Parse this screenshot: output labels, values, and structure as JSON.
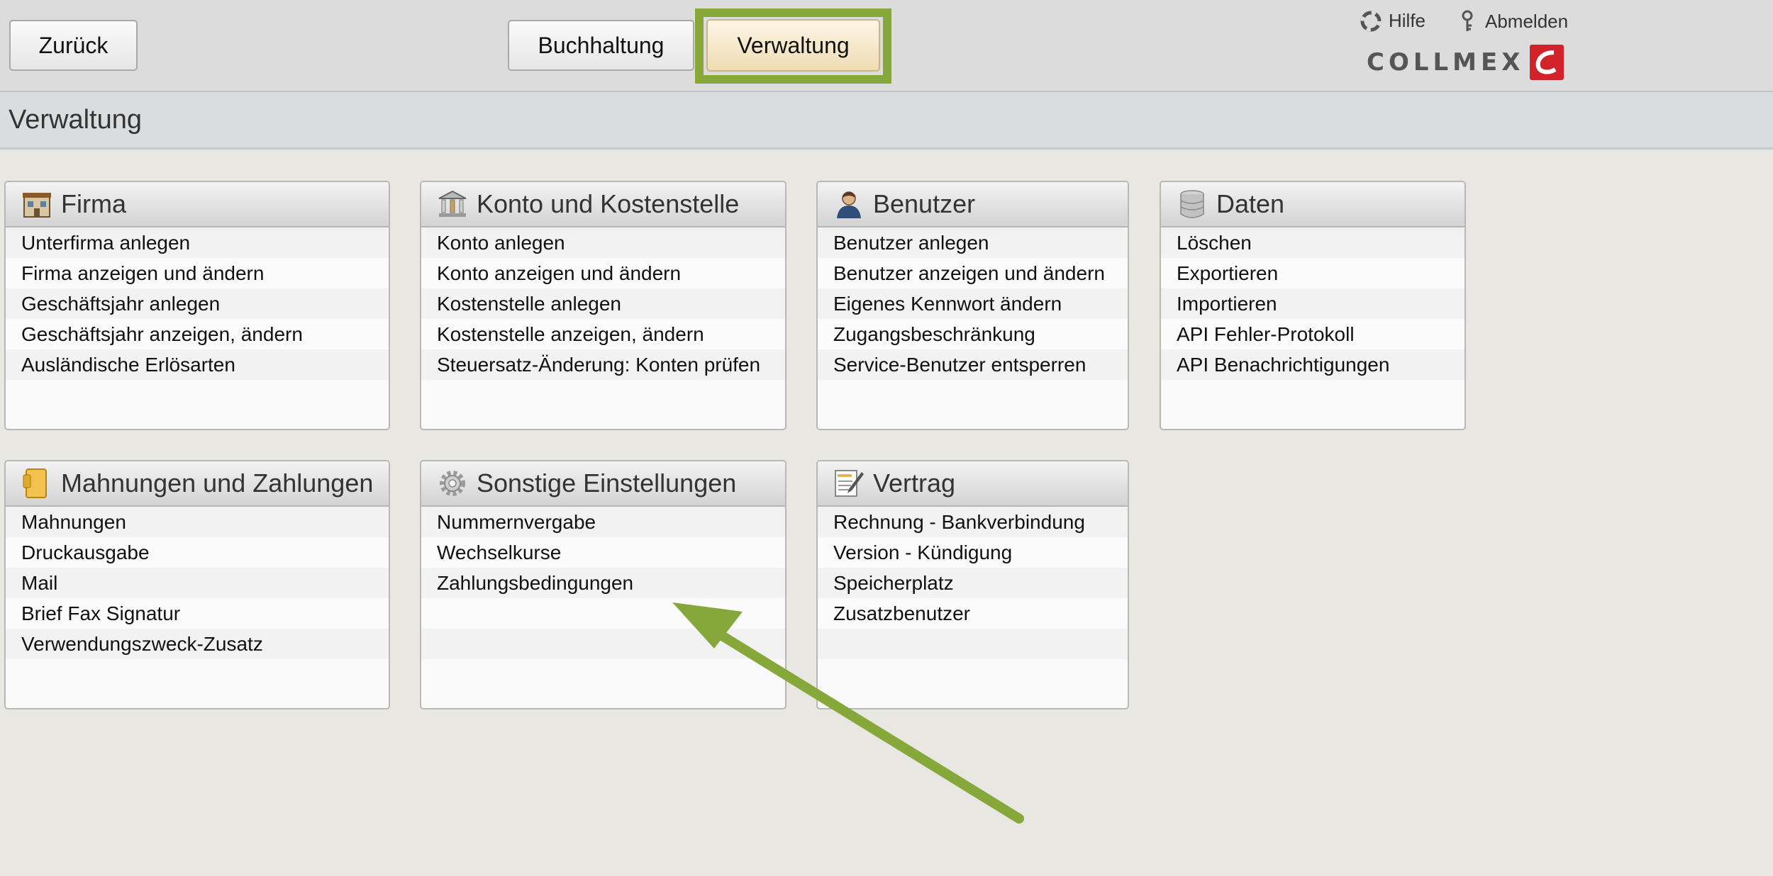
{
  "toolbar": {
    "back_label": "Zurück",
    "buchhaltung_label": "Buchhaltung",
    "verwaltung_label": "Verwaltung",
    "help_label": "Hilfe",
    "logout_label": "Abmelden",
    "logo_text": "COLLMEX"
  },
  "page": {
    "title": "Verwaltung"
  },
  "panels": [
    {
      "title": "Firma",
      "icon": "building-icon",
      "items": [
        "Unterfirma anlegen",
        "Firma anzeigen und ändern",
        "Geschäftsjahr anlegen",
        "Geschäftsjahr anzeigen, ändern",
        "Ausländische Erlösarten"
      ]
    },
    {
      "title": "Konto und Kostenstelle",
      "icon": "bank-icon",
      "items": [
        "Konto anlegen",
        "Konto anzeigen und ändern",
        "Kostenstelle anlegen",
        "Kostenstelle anzeigen, ändern",
        "Steuersatz-Änderung: Konten prüfen"
      ]
    },
    {
      "title": "Benutzer",
      "icon": "user-icon",
      "items": [
        "Benutzer anlegen",
        "Benutzer anzeigen und ändern",
        "Eigenes Kennwort ändern",
        "Zugangsbeschränkung",
        "Service-Benutzer entsperren"
      ]
    },
    {
      "title": "Daten",
      "icon": "database-icon",
      "items": [
        "Löschen",
        "Exportieren",
        "Importieren",
        "API Fehler-Protokoll",
        "API Benachrichtigungen"
      ]
    },
    {
      "title": "Mahnungen und Zahlungen",
      "icon": "folder-icon",
      "items": [
        "Mahnungen",
        "Druckausgabe",
        "Mail",
        "Brief Fax Signatur",
        "Verwendungszweck-Zusatz"
      ]
    },
    {
      "title": "Sonstige Einstellungen",
      "icon": "gear-icon",
      "items": [
        "Nummernvergabe",
        "Wechselkurse",
        "Zahlungsbedingungen",
        "",
        ""
      ]
    },
    {
      "title": "Vertrag",
      "icon": "contract-icon",
      "items": [
        "Rechnung - Bankverbindung",
        "Version - Kündigung",
        "Speicherplatz",
        "Zusatzbenutzer",
        ""
      ]
    }
  ],
  "colors": {
    "highlight": "#86a83b",
    "logo_red": "#d2232a",
    "active_tab": "#efdcb2"
  }
}
